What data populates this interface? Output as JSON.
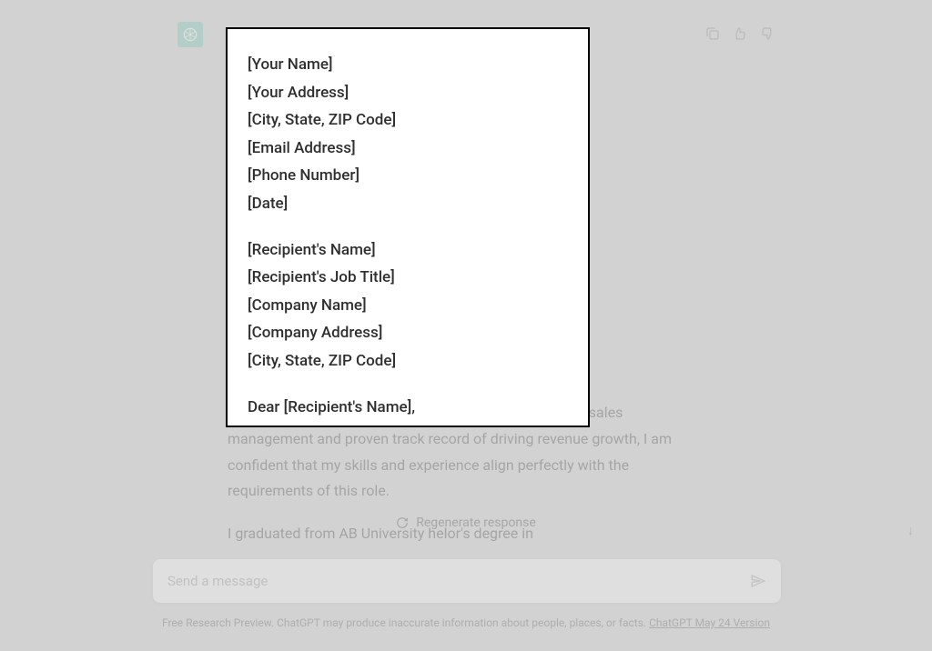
{
  "avatar_alt": "assistant-logo",
  "background": {
    "para1_visible": "er position at Iversal, Inc. With my strong background in sales management and proven track record of driving revenue growth, I am confident that my skills and experience align perfectly with the requirements of this role.",
    "para2_visible": "I graduated from AB University                              helor's degree in"
  },
  "regenerate_label": "Regenerate response",
  "input_placeholder": "Send a message",
  "footer_text": "Free Research Preview. ChatGPT may produce inaccurate information about people, places, or facts. ",
  "footer_link_text": "ChatGPT May 24 Version",
  "modal": {
    "sender": [
      "[Your Name]",
      "[Your Address]",
      "[City, State, ZIP Code]",
      "[Email Address]",
      "[Phone Number]",
      "[Date]"
    ],
    "recipient": [
      "[Recipient's Name]",
      "[Recipient's Job Title]",
      "[Company Name]",
      "[Company Address]",
      "[City, State, ZIP Code]"
    ],
    "salutation": "Dear [Recipient's Name],"
  }
}
